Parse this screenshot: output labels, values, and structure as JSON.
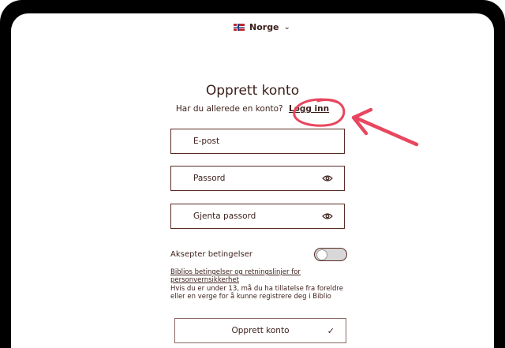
{
  "region": {
    "flag_icon": "norway-flag-icon",
    "label": "Norge",
    "chevron_icon": "chevron-down-icon"
  },
  "form": {
    "title": "Opprett konto",
    "have_account": "Har du allerede en konto?",
    "login_link": "Logg inn",
    "email_placeholder": "E-post",
    "password_placeholder": "Passord",
    "repeat_password_placeholder": "Gjenta passord",
    "eye_icon": "eye-icon",
    "accept_terms_label": "Aksepter betingelser",
    "accept_terms_on": false,
    "terms_link": "Biblios betingelser og retningslinjer for personvernsikkerhet",
    "terms_note": "Hvis du er under 13, må du ha tillatelse fra foreldre eller en verge for å kunne registrere deg i Biblio",
    "submit_label": "Opprett konto",
    "submit_check_icon": "check-icon"
  },
  "annotation": {
    "color": "#e8475f"
  },
  "colors": {
    "text": "#3b1f1a",
    "border": "#5a2a22",
    "frame": "#000000"
  }
}
